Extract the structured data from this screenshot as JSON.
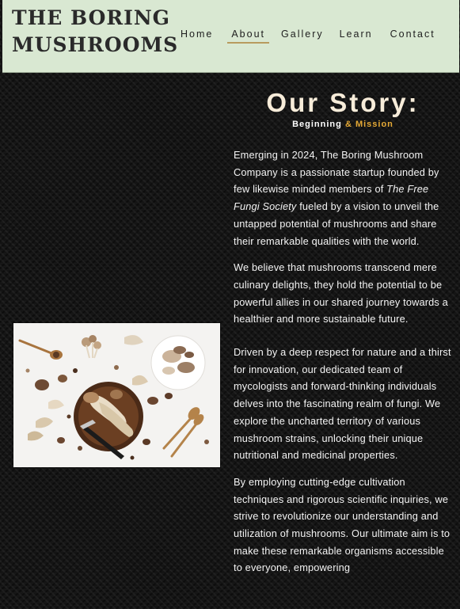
{
  "header": {
    "logo_line1": "THE BORING",
    "logo_line2": "MUSHROOMS",
    "nav": [
      {
        "label": "Home"
      },
      {
        "label": "About"
      },
      {
        "label": "Gallery"
      },
      {
        "label": "Learn"
      },
      {
        "label": "Contact"
      }
    ],
    "active_nav": "About",
    "accent_color": "#b89b5e"
  },
  "story": {
    "title": "Our Story:",
    "subtitle_part1": "Beginning",
    "subtitle_part2": "& Mission",
    "subtitle_accent_color": "#e5a935",
    "p1_text1": "Emerging in 2024, The Boring Mushroom Company is a passionate startup founded by few likewise minded members of",
    "p1_italic": "The Free Fungi Society",
    "p1_text2": "fueled by a vision to unveil the untapped potential of mushrooms and share their remarkable qualities with the world.",
    "p2": "We believe that mushrooms transcend mere culinary delights, they hold the potential to be powerful allies in our shared journey towards a healthier and more sustainable future.",
    "p3": "Driven by a deep respect for nature and a thirst for innovation, our dedicated team of mycologists and forward-thinking individuals delves into the fascinating realm of fungi. We explore the uncharted territory of various mushroom strains, unlocking their unique nutritional and medicinal properties.",
    "p4": "By employing cutting-edge cultivation techniques and rigorous scientific inquiries, we strive to revolutionize our understanding and utilization of mushrooms. Our ultimate aim is to make these remarkable organisms accessible to everyone, empowering"
  },
  "image": {
    "subject": "assorted mushrooms on white surface with wooden board, spoons and knife"
  }
}
